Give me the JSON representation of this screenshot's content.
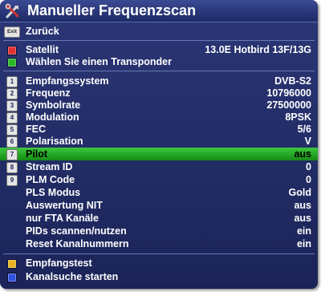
{
  "title": "Manueller Frequenzscan",
  "colors": {
    "background": "#1f2a63",
    "highlight": "#2bb52b",
    "red": "#e23030",
    "green": "#28b828",
    "yellow": "#e8b420",
    "blue": "#3050e0"
  },
  "back": {
    "key": "Exit",
    "label": "Zurück"
  },
  "satellite": {
    "label": "Satellit",
    "value": "13.0E Hotbird 13F/13G"
  },
  "transponder": {
    "label": "Wählen Sie einen Transponder"
  },
  "settings": [
    {
      "key": "1",
      "label": "Empfangssystem",
      "value": "DVB-S2"
    },
    {
      "key": "2",
      "label": "Frequenz",
      "value": "10796000"
    },
    {
      "key": "3",
      "label": "Symbolrate",
      "value": "27500000"
    },
    {
      "key": "4",
      "label": "Modulation",
      "value": "8PSK"
    },
    {
      "key": "5",
      "label": "FEC",
      "value": "5/6"
    },
    {
      "key": "6",
      "label": "Polarisation",
      "value": "V"
    },
    {
      "key": "7",
      "label": "Pilot",
      "value": "aus"
    },
    {
      "key": "8",
      "label": "Stream ID",
      "value": "0"
    },
    {
      "key": "9",
      "label": "PLM Code",
      "value": "0"
    },
    {
      "key": "",
      "label": "PLS Modus",
      "value": "Gold"
    },
    {
      "key": "",
      "label": "Auswertung NIT",
      "value": "aus"
    },
    {
      "key": "",
      "label": "nur FTA Kanäle",
      "value": "aus"
    },
    {
      "key": "",
      "label": "PIDs scannen/nutzen",
      "value": "ein"
    },
    {
      "key": "",
      "label": "Reset Kanalnummern",
      "value": "ein"
    }
  ],
  "actions": [
    {
      "label": "Empfangstest"
    },
    {
      "label": "Kanalsuche starten"
    }
  ]
}
